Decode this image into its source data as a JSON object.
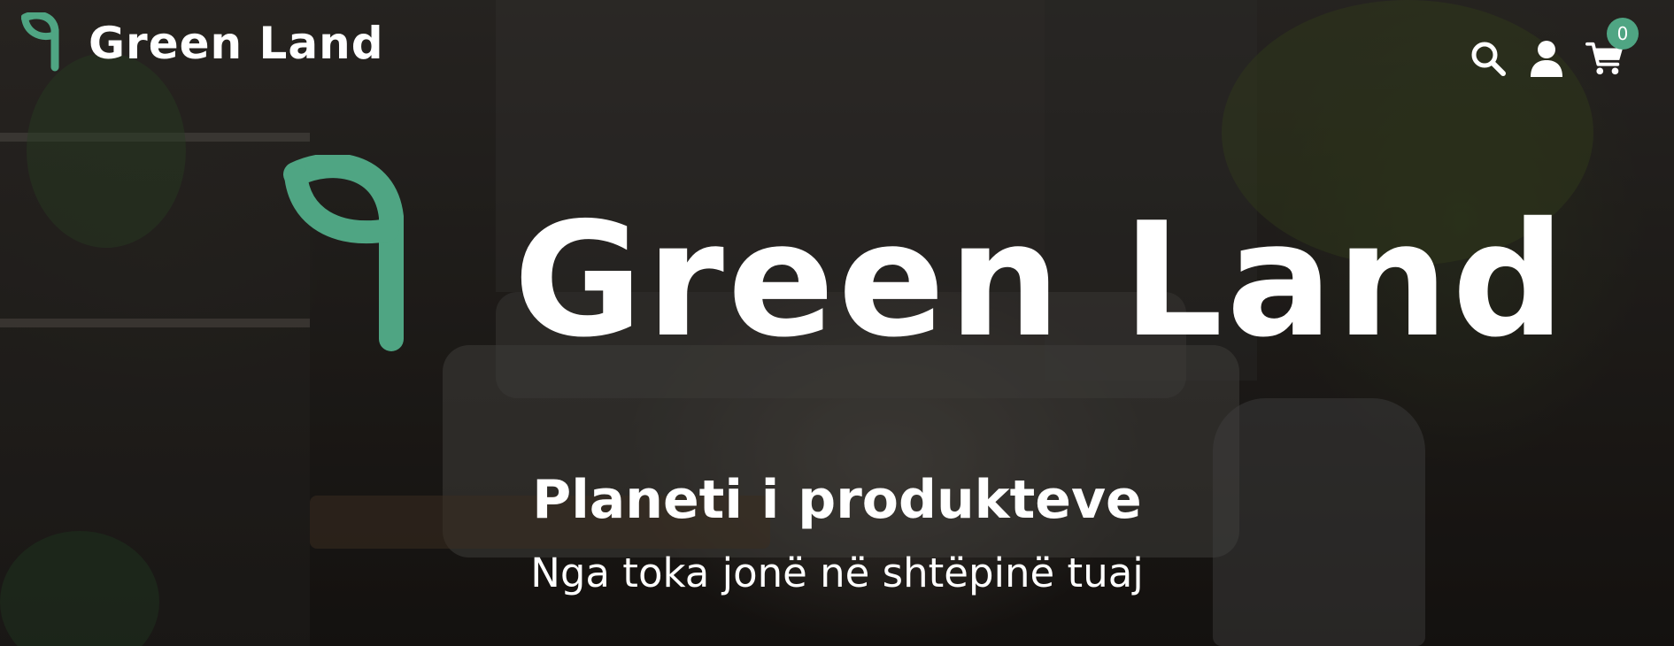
{
  "header": {
    "brand_name": "Green Land",
    "cart_count": "0",
    "icons": [
      "leaf-logo-icon",
      "search-icon",
      "user-icon",
      "cart-icon"
    ]
  },
  "hero": {
    "brand_name": "Green Land",
    "heading": "Planeti i produkteve",
    "subheading": "Nga toka jonë në shtëpinë tuaj"
  },
  "colors": {
    "accent": "#4fa583",
    "text": "#ffffff"
  }
}
